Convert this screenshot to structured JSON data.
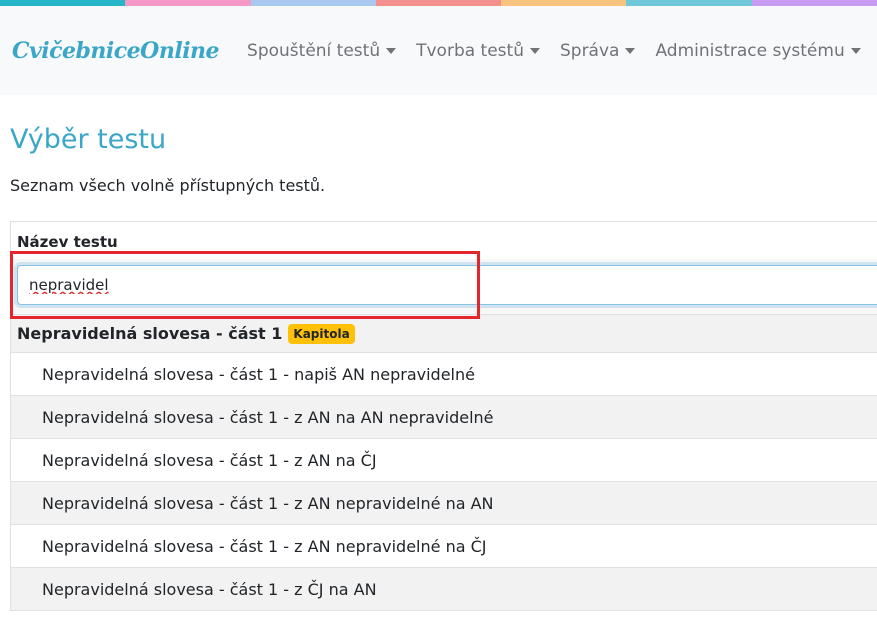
{
  "rainbow_colors": [
    "#27b6c8",
    "#f598c6",
    "#a9c8f0",
    "#f38f8f",
    "#f8c27f",
    "#6fc7d9",
    "#c89bf2"
  ],
  "brand": "CvičebniceOnline",
  "nav": [
    {
      "label": "Spouštění testů"
    },
    {
      "label": "Tvorba testů"
    },
    {
      "label": "Správa"
    },
    {
      "label": "Administrace systému"
    }
  ],
  "page": {
    "title": "Výběr testu",
    "description": "Seznam všech volně přístupných testů."
  },
  "table": {
    "column_header": "Název testu",
    "filter_value": "nepravidel",
    "chapter": {
      "title": "Nepravidelná slovesa - část 1",
      "badge": "Kapitola"
    },
    "rows": [
      "Nepravidelná slovesa - část 1 - napiš AN nepravidelné",
      "Nepravidelná slovesa - část 1 - z AN na AN nepravidelné",
      "Nepravidelná slovesa - část 1 - z AN na ČJ",
      "Nepravidelná slovesa - část 1 - z AN nepravidelné na AN",
      "Nepravidelná slovesa - část 1 - z AN nepravidelné na ČJ",
      "Nepravidelná slovesa - část 1 - z ČJ na AN"
    ]
  },
  "colors": {
    "accent": "#3aa6c8",
    "highlight": "#e3262d",
    "badge": "#ffc107"
  }
}
